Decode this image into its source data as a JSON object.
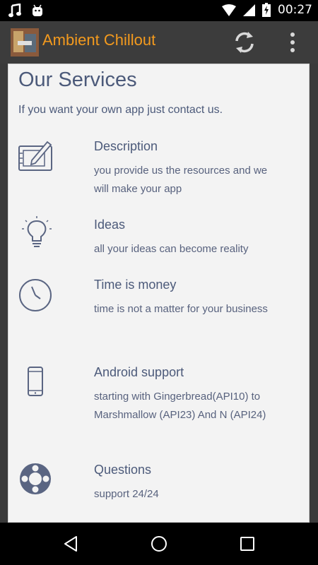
{
  "status_bar": {
    "time": "00:27"
  },
  "app_bar": {
    "title": "Ambient Chillout"
  },
  "content": {
    "title": "Our Services",
    "subtitle": "If you want your own app just contact us.",
    "services": [
      {
        "icon": "tablet-pen-icon",
        "title": "Description",
        "desc": "you provide us the resources and we will make your app"
      },
      {
        "icon": "lightbulb-icon",
        "title": "Ideas",
        "desc": "all your ideas can become reality"
      },
      {
        "icon": "clock-icon",
        "title": "Time is money",
        "desc": "time is not a matter for your business"
      },
      {
        "icon": "phone-icon",
        "title": "Android support",
        "desc": "starting with Gingerbread(API10) to Marshmallow (API23) And N (API24)"
      },
      {
        "icon": "lifebuoy-icon",
        "title": "Questions",
        "desc": "support 24/24"
      }
    ]
  },
  "colors": {
    "accent": "#f39a1e",
    "text": "#4c5a7a",
    "card_bg": "#f3f3f3",
    "app_bar": "#3c3c3c"
  }
}
